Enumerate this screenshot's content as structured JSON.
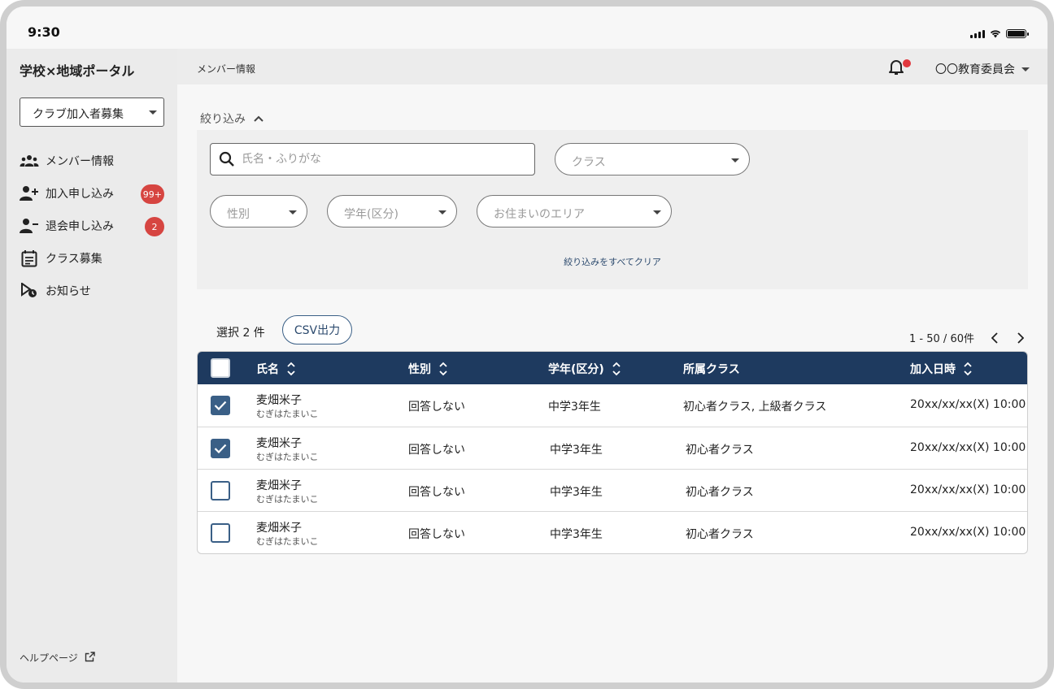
{
  "status": {
    "time": "9:30"
  },
  "sidebar": {
    "portal_title": "学校×地域ポータル",
    "club_select": "クラブ加入者募集",
    "items": [
      {
        "label": "メンバー情報",
        "icon": "people-icon"
      },
      {
        "label": "加入申し込み",
        "icon": "person-add-icon",
        "badge": "99+"
      },
      {
        "label": "退会申し込み",
        "icon": "person-remove-icon",
        "badge": "2"
      },
      {
        "label": "クラス募集",
        "icon": "calendar-list-icon"
      },
      {
        "label": "お知らせ",
        "icon": "announcement-icon"
      }
    ],
    "help": "ヘルプページ"
  },
  "header": {
    "breadcrumb": "メンバー情報",
    "account": "〇〇教育委員会"
  },
  "filter": {
    "toggle_label": "絞り込み",
    "search_placeholder": "氏名・ふりがな",
    "class_placeholder": "クラス",
    "gender_placeholder": "性別",
    "grade_placeholder": "学年(区分)",
    "area_placeholder": "お住まいのエリア",
    "clear_all": "絞り込みをすべてクリア"
  },
  "toolbar": {
    "selected": "選択 2 件",
    "csv": "CSV出力",
    "pagination": "1 - 50 / 60件"
  },
  "table": {
    "columns": [
      "氏名",
      "性別",
      "学年(区分)",
      "所属クラス",
      "加入日時"
    ],
    "rows": [
      {
        "checked": true,
        "name": "麦畑米子",
        "kana": "むぎはたまいこ",
        "gender": "回答しない",
        "grade": "中学3年生",
        "class": "初心者クラス, 上級者クラス",
        "joined": "20xx/xx/xx(X) 10:00"
      },
      {
        "checked": true,
        "name": "麦畑米子",
        "kana": "むぎはたまいこ",
        "gender": "回答しない",
        "grade": "中学3年生",
        "class": "初心者クラス",
        "joined": "20xx/xx/xx(X) 10:00"
      },
      {
        "checked": false,
        "name": "麦畑米子",
        "kana": "むぎはたまいこ",
        "gender": "回答しない",
        "grade": "中学3年生",
        "class": "初心者クラス",
        "joined": "20xx/xx/xx(X) 10:00"
      },
      {
        "checked": false,
        "name": "麦畑米子",
        "kana": "むぎはたまいこ",
        "gender": "回答しない",
        "grade": "中学3年生",
        "class": "初心者クラス",
        "joined": "20xx/xx/xx(X) 10:00"
      }
    ]
  },
  "colors": {
    "primary": "#1e3a5f",
    "accent": "#3a5f86",
    "badge": "#d64541"
  }
}
